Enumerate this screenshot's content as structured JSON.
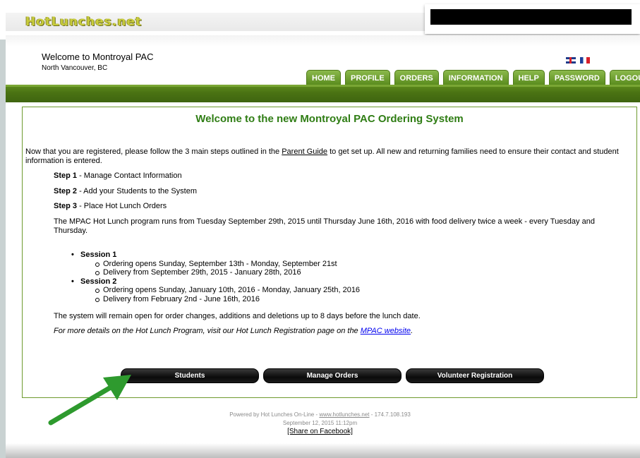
{
  "site": {
    "logo_text": "HotLunches.net"
  },
  "header": {
    "welcome": "Welcome to Montroyal PAC",
    "location": "North Vancouver, BC"
  },
  "nav": {
    "tabs": [
      "HOME",
      "PROFILE",
      "ORDERS",
      "INFORMATION",
      "HELP",
      "PASSWORD",
      "LOGOUT"
    ]
  },
  "main": {
    "title": "Welcome to the new Montroyal PAC Ordering System",
    "intro_before": "Now that you are registered, please follow the 3 main steps outlined in the ",
    "intro_link": "Parent Guide",
    "intro_after": " to get set up.  All new and returning families need to ensure their contact and student information is entered.",
    "steps": [
      {
        "label": "Step 1",
        "text": " - Manage Contact Information"
      },
      {
        "label": "Step 2",
        "text": " - Add your Students to the System"
      },
      {
        "label": "Step 3",
        "text": " - Place Hot Lunch Orders"
      }
    ],
    "program_text": "The MPAC Hot Lunch program runs from Tuesday September 29th, 2015 until Thursday June 16th, 2016 with food delivery twice a week - every Tuesday and Thursday.",
    "sessions": [
      {
        "name": "Session 1",
        "ordering": "Ordering opens Sunday, September 13th - Monday, September 21st",
        "delivery": "Delivery from September 29th, 2015 - January 28th, 2016"
      },
      {
        "name": "Session 2",
        "ordering": "Ordering opens Sunday, January 10th, 2016 - Monday, January 25th, 2016",
        "delivery": "Delivery from February 2nd - June 16th, 2016"
      }
    ],
    "changes_text": "The system will remain open for order changes, additions and deletions up to 8 days before the lunch date.",
    "details_before": "For more details on the Hot Lunch Program, visit our Hot Lunch Registration page on the ",
    "details_link": "MPAC website",
    "details_after": ".",
    "buttons": [
      "Students",
      "Manage Orders",
      "Volunteer Registration"
    ]
  },
  "footer": {
    "powered_before": "Powered by Hot Lunches On-Line - ",
    "powered_link": "www.hotlunches.net",
    "powered_after": " - 174.7.108.193",
    "timestamp": "September 12, 2015 11:12pm",
    "share": "[Share on Facebook]"
  },
  "colors": {
    "nav_green": "#5a8c1e",
    "title_green": "#2f7d14",
    "annotation_arrow": "#2e9a2e"
  }
}
